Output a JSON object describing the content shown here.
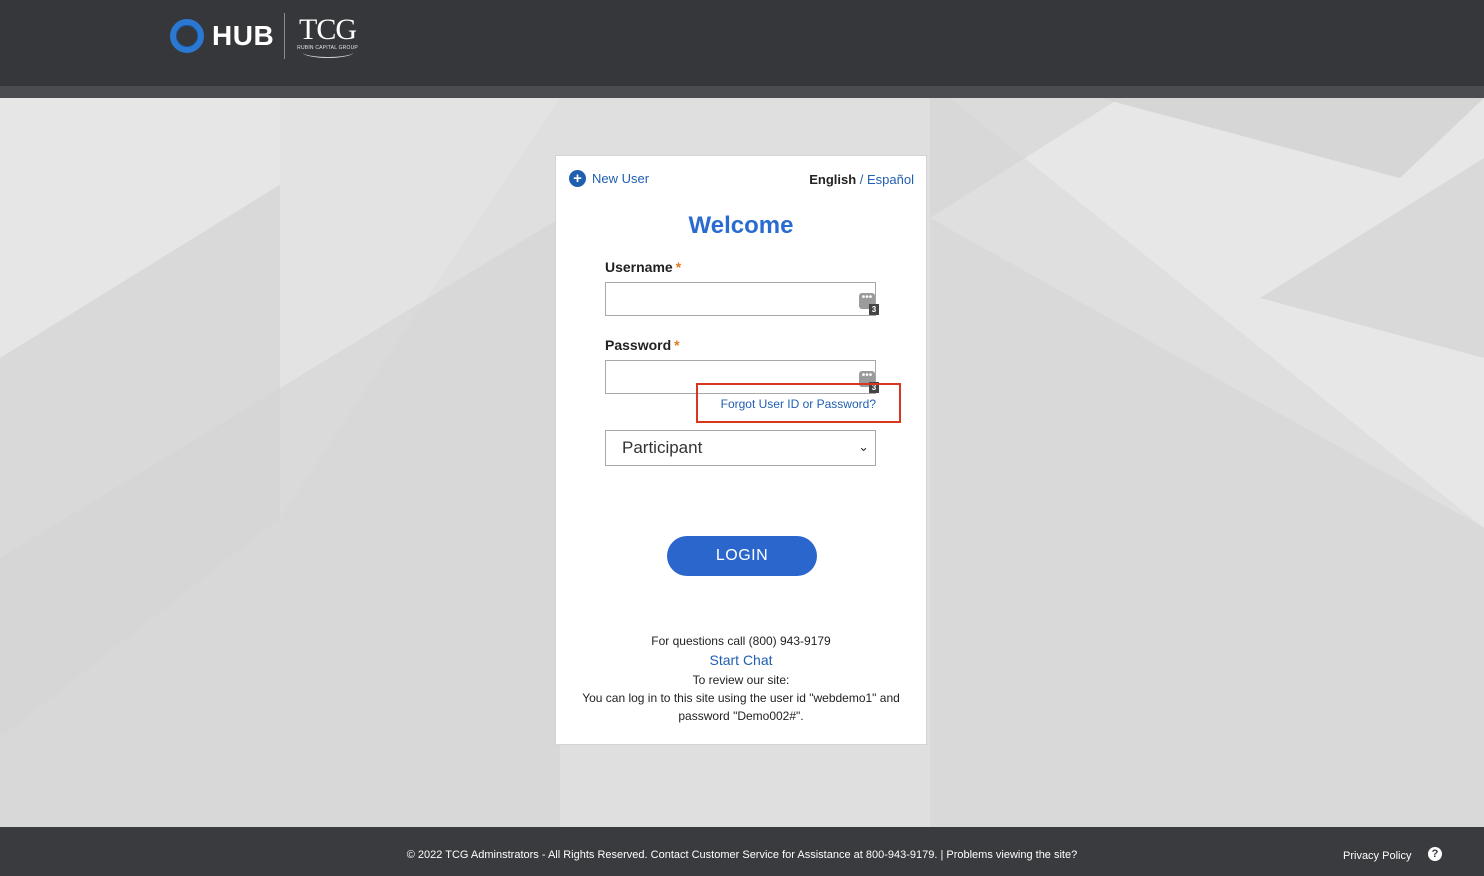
{
  "header": {
    "hub_text": "HUB",
    "tcg_text": "TCG",
    "tcg_subtext": "RUBIN CAPITAL GROUP"
  },
  "card": {
    "new_user_label": "New User",
    "lang_english": "English",
    "lang_separator": " / ",
    "lang_spanish": "Español",
    "welcome": "Welcome",
    "username_label": "Username",
    "password_label": "Password",
    "required_mark": "*",
    "username_value": "",
    "password_value": "",
    "password_manager_badge": "3",
    "forgot_label": "Forgot User ID or Password?",
    "role_selected": "Participant",
    "login_label": "LOGIN",
    "questions_text": "For questions call (800) 943-9179",
    "chat_label": "Start Chat",
    "review_text": "To review our site:",
    "demo_text_line1": "You can log in to this site using the user id \"webdemo1\" and",
    "demo_text_line2": "password \"Demo002#\"."
  },
  "footer": {
    "copyright": "© 2022 TCG Adminstrators - All Rights Reserved. Contact Customer Service for Assistance at 800-943-9179. | Problems viewing the site?",
    "privacy_label": "Privacy Policy",
    "help_glyph": "?"
  },
  "colors": {
    "brand_blue": "#2a66cc",
    "link_blue": "#1f5fb0",
    "highlight_red": "#d9361e",
    "required_orange": "#e07a1f",
    "header_dark": "#35373a"
  },
  "icons": [
    "plus-circle-icon",
    "password-manager-icon",
    "chevron-down-icon",
    "help-icon"
  ]
}
